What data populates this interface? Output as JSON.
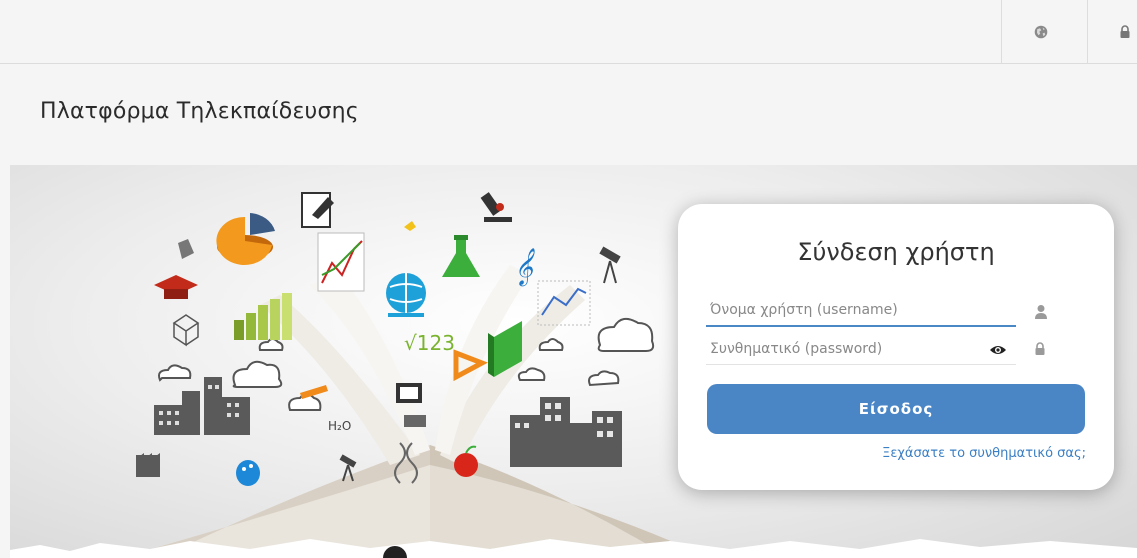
{
  "topbar": {
    "language_icon": "globe-icon",
    "login_icon": "lock-icon"
  },
  "header": {
    "title": "Πλατφόρμα Τηλεκπαίδευσης"
  },
  "login": {
    "title": "Σύνδεση χρήστη",
    "username_placeholder": "Όνομα χρήστη (username)",
    "password_placeholder": "Συνθηματικό (password)",
    "submit_label": "Είσοδος",
    "forgot_label": "Ξεχάσατε το συνθηματικό σας;",
    "icons": {
      "user": "user-icon",
      "lock": "lock-icon",
      "show_password": "eye-icon"
    }
  },
  "hero": {
    "labels": {
      "sqrt": "√123",
      "water": "H₂O"
    }
  },
  "colors": {
    "primary": "#4a85c6",
    "link": "#3b7fc4",
    "background": "#f5f5f5"
  }
}
